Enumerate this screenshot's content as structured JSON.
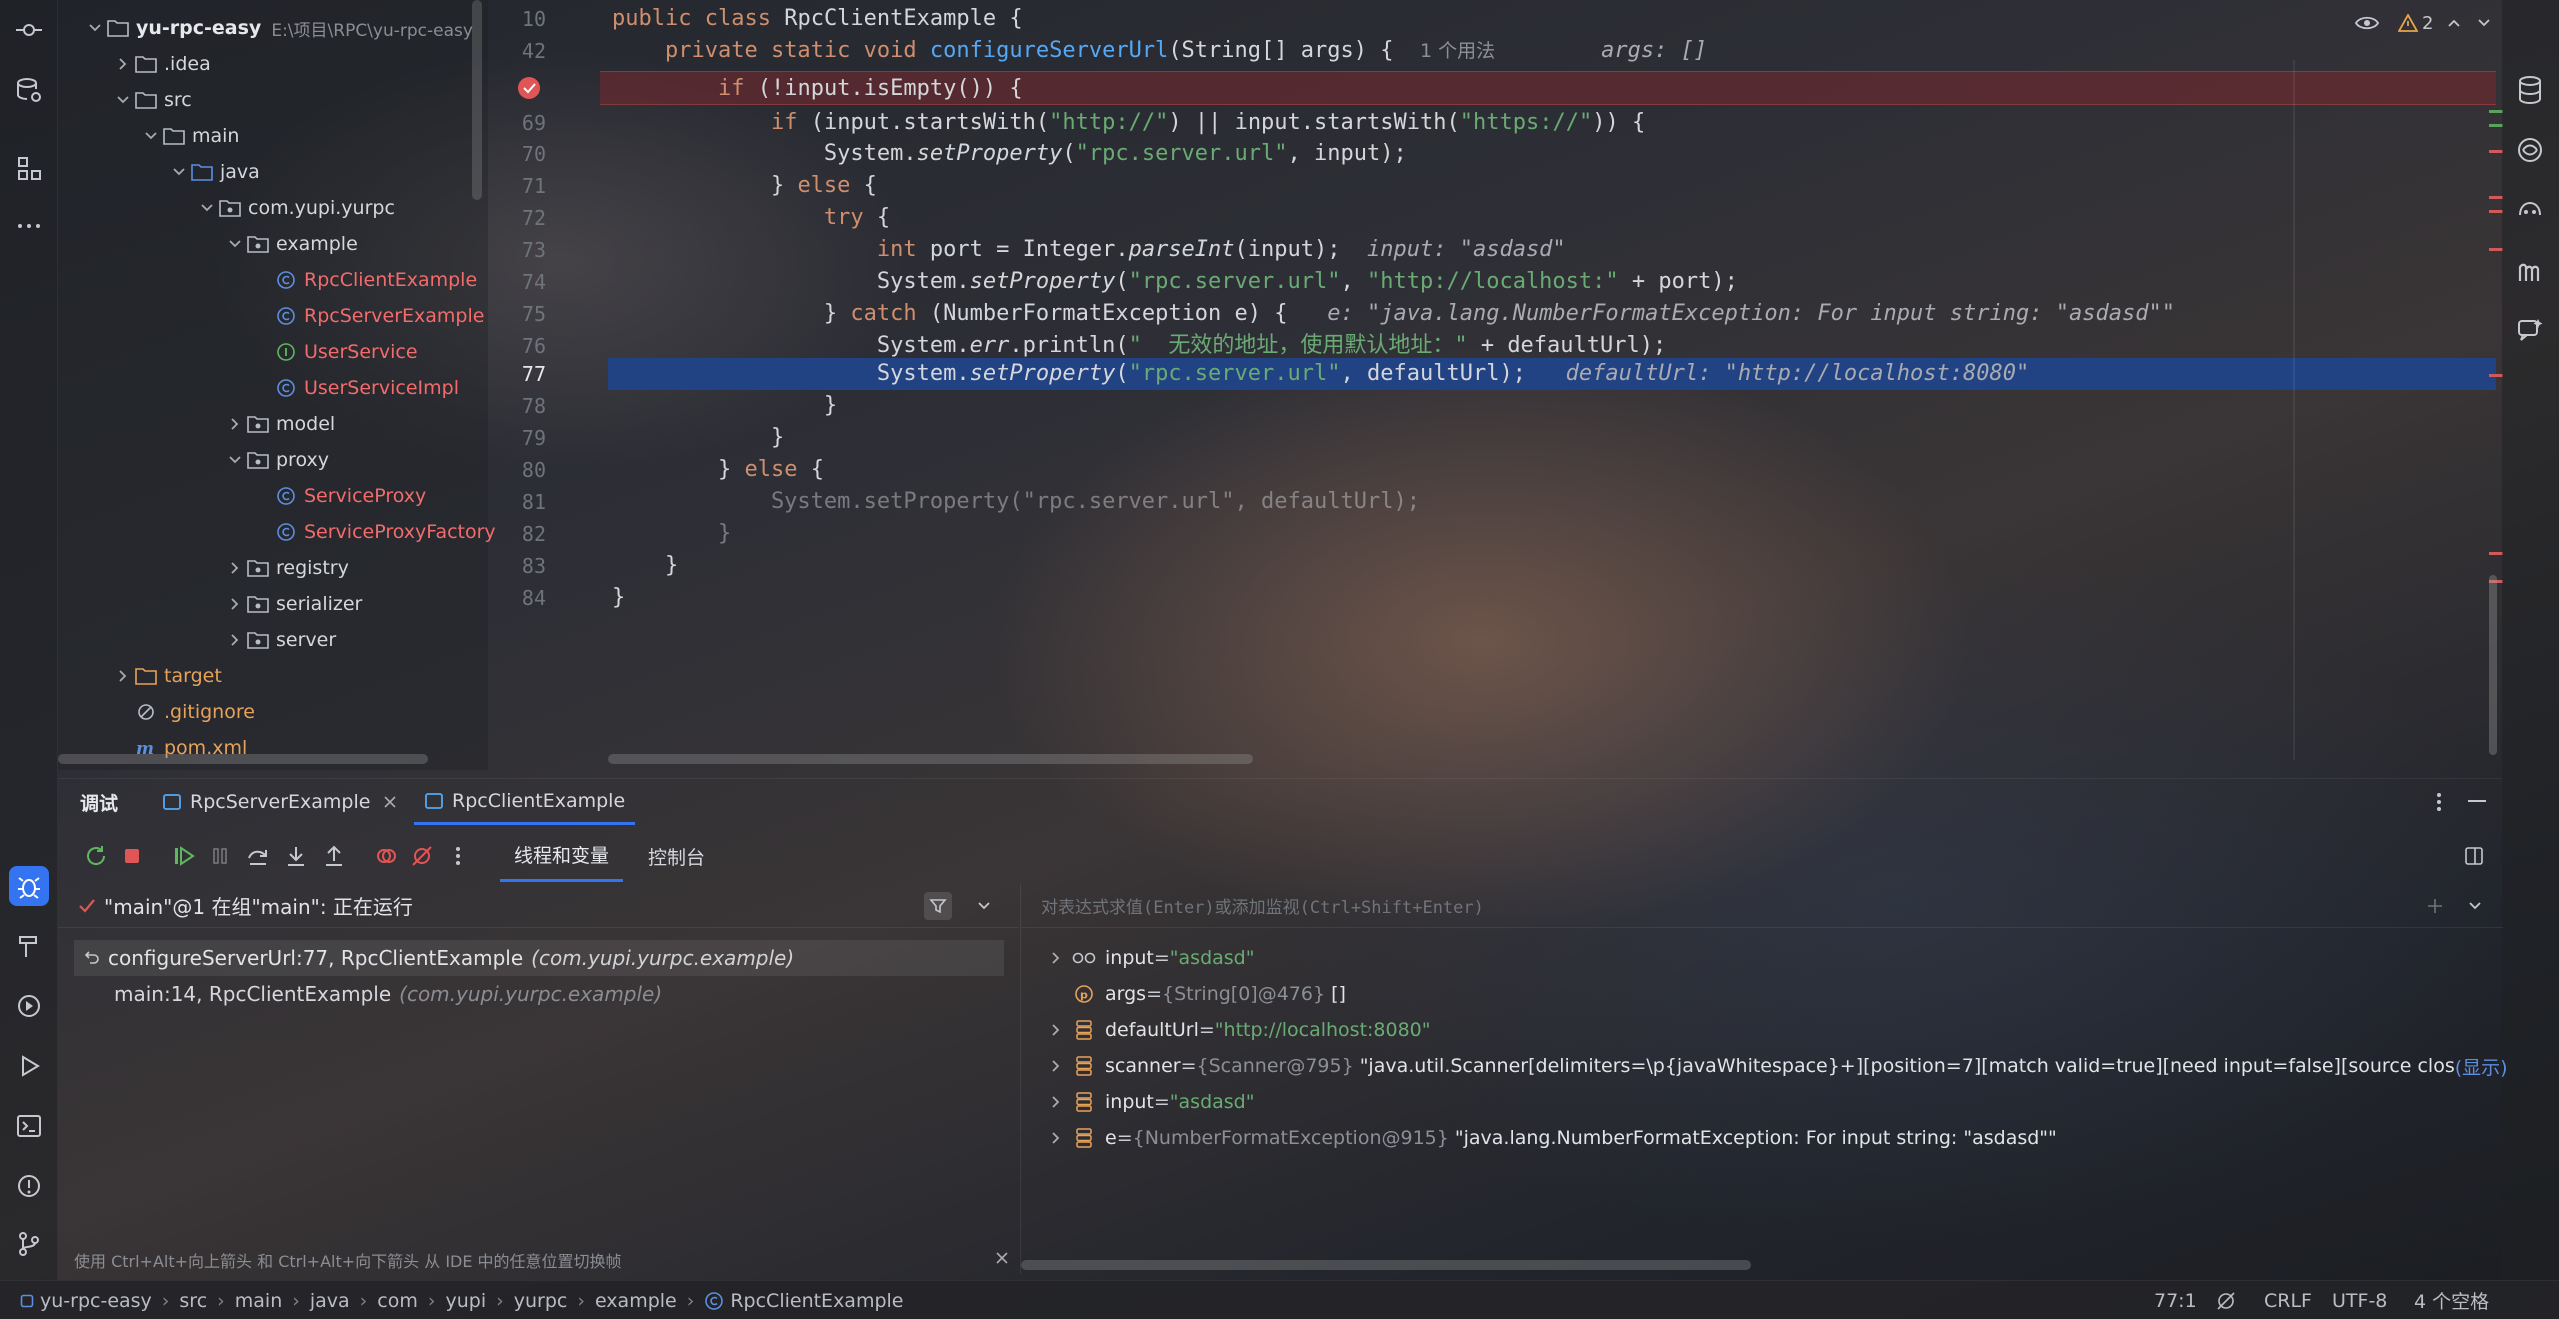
{
  "project": {
    "name": "yu-rpc-easy",
    "path": "E:\\项目\\RPC\\yu-rpc-easy",
    "tree": [
      {
        "label": ".idea",
        "depth": 1,
        "kind": "folder",
        "expanded": false
      },
      {
        "label": "src",
        "depth": 1,
        "kind": "folder",
        "expanded": true
      },
      {
        "label": "main",
        "depth": 2,
        "kind": "folder",
        "expanded": true
      },
      {
        "label": "java",
        "depth": 3,
        "kind": "folder-blue",
        "expanded": true
      },
      {
        "label": "com.yupi.yurpc",
        "depth": 4,
        "kind": "package",
        "expanded": true
      },
      {
        "label": "example",
        "depth": 5,
        "kind": "package",
        "expanded": true
      },
      {
        "label": "RpcClientExample",
        "depth": 6,
        "kind": "class",
        "color": "red"
      },
      {
        "label": "RpcServerExample",
        "depth": 6,
        "kind": "class",
        "color": "red"
      },
      {
        "label": "UserService",
        "depth": 6,
        "kind": "interface",
        "color": "red"
      },
      {
        "label": "UserServiceImpl",
        "depth": 6,
        "kind": "class",
        "color": "red"
      },
      {
        "label": "model",
        "depth": 5,
        "kind": "package",
        "expanded": false
      },
      {
        "label": "proxy",
        "depth": 5,
        "kind": "package",
        "expanded": true
      },
      {
        "label": "ServiceProxy",
        "depth": 6,
        "kind": "class",
        "color": "red"
      },
      {
        "label": "ServiceProxyFactory",
        "depth": 6,
        "kind": "class",
        "color": "red"
      },
      {
        "label": "registry",
        "depth": 5,
        "kind": "package",
        "expanded": false
      },
      {
        "label": "serializer",
        "depth": 5,
        "kind": "package",
        "expanded": false
      },
      {
        "label": "server",
        "depth": 5,
        "kind": "package",
        "expanded": false
      },
      {
        "label": "target",
        "depth": 1,
        "kind": "folder-orange",
        "expanded": false,
        "color": "orange"
      },
      {
        "label": ".gitignore",
        "depth": 1,
        "kind": "ignore",
        "color": "orange"
      },
      {
        "label": "pom.xml",
        "depth": 1,
        "kind": "maven",
        "color": "orange"
      }
    ]
  },
  "editor": {
    "inspection_count": "2",
    "lines": [
      {
        "n": "10",
        "code": [
          [
            "kw",
            "public "
          ],
          [
            "kw",
            "class "
          ],
          [
            "",
            "RpcClientExample {"
          ]
        ]
      },
      {
        "n": "42",
        "code": [
          [
            "",
            "    "
          ],
          [
            "kw",
            "private static void "
          ],
          [
            "fn",
            "configureServerUrl"
          ],
          [
            "",
            "(String[] args) {  "
          ],
          [
            "hint2",
            "1 个用法"
          ],
          [
            "",
            "        "
          ],
          [
            "hint",
            "args: []"
          ]
        ]
      },
      {
        "n": "",
        "code": [
          [
            "",
            "        "
          ],
          [
            "kw",
            "if "
          ],
          [
            "",
            "(!input.isEmpty()) {"
          ]
        ]
      },
      {
        "n": "69",
        "code": [
          [
            "",
            "            "
          ],
          [
            "kw",
            "if "
          ],
          [
            "",
            "(input.startsWith("
          ],
          [
            "str",
            "\"http://\""
          ],
          [
            "",
            ") || input.startsWith("
          ],
          [
            "str",
            "\"https://\""
          ],
          [
            "",
            ")) {"
          ]
        ]
      },
      {
        "n": "70",
        "code": [
          [
            "",
            "                System."
          ],
          [
            "it",
            "setProperty"
          ],
          [
            "",
            "("
          ],
          [
            "str",
            "\"rpc.server.url\""
          ],
          [
            "",
            ", input);"
          ]
        ]
      },
      {
        "n": "71",
        "code": [
          [
            "",
            "            } "
          ],
          [
            "kw",
            "else "
          ],
          [
            "",
            "{"
          ]
        ]
      },
      {
        "n": "72",
        "code": [
          [
            "",
            "                "
          ],
          [
            "kw",
            "try "
          ],
          [
            "",
            "{"
          ]
        ]
      },
      {
        "n": "73",
        "code": [
          [
            "",
            "                    "
          ],
          [
            "kw",
            "int "
          ],
          [
            "",
            "port = Integer."
          ],
          [
            "it",
            "parseInt"
          ],
          [
            "",
            "(input);  "
          ],
          [
            "hint",
            "input: \"asdasd\""
          ]
        ]
      },
      {
        "n": "74",
        "code": [
          [
            "",
            "                    System."
          ],
          [
            "it",
            "setProperty"
          ],
          [
            "",
            "("
          ],
          [
            "str",
            "\"rpc.server.url\""
          ],
          [
            "",
            ", "
          ],
          [
            "str",
            "\"http://localhost:\""
          ],
          [
            "",
            " + port);"
          ]
        ]
      },
      {
        "n": "75",
        "code": [
          [
            "",
            "                } "
          ],
          [
            "kw",
            "catch "
          ],
          [
            "",
            "(NumberFormatException e) {   "
          ],
          [
            "hint",
            "e: \"java.lang.NumberFormatException: For input string: \"asdasd\"\""
          ]
        ]
      },
      {
        "n": "76",
        "code": [
          [
            "",
            "                    System."
          ],
          [
            "it",
            "err"
          ],
          [
            "",
            ".println("
          ],
          [
            "str",
            "\"  无效的地址，使用默认地址：\""
          ],
          [
            "",
            " + defaultUrl);"
          ]
        ]
      },
      {
        "n": "77",
        "code": [
          [
            "",
            "                    System."
          ],
          [
            "it",
            "setProperty"
          ],
          [
            "",
            "("
          ],
          [
            "str",
            "\"rpc.server.url\""
          ],
          [
            "",
            ", defaultUrl);   "
          ],
          [
            "hint",
            "defaultUrl: \"http://localhost:8080\""
          ]
        ]
      },
      {
        "n": "78",
        "code": [
          [
            "",
            "                }"
          ]
        ]
      },
      {
        "n": "79",
        "code": [
          [
            "",
            "            }"
          ]
        ]
      },
      {
        "n": "80",
        "code": [
          [
            "",
            "        } "
          ],
          [
            "kw",
            "else "
          ],
          [
            "",
            "{"
          ]
        ]
      },
      {
        "n": "81",
        "code": [
          [
            "dimcode",
            "            System.setProperty(\"rpc.server.url\", defaultUrl);"
          ]
        ]
      },
      {
        "n": "82",
        "code": [
          [
            "dimcode",
            "        }"
          ]
        ]
      },
      {
        "n": "83",
        "code": [
          [
            "",
            "    }"
          ]
        ]
      },
      {
        "n": "84",
        "code": [
          [
            "",
            "}"
          ]
        ]
      }
    ]
  },
  "debug": {
    "panel_title": "调试",
    "tabs": [
      "RpcServerExample",
      "RpcClientExample"
    ],
    "subtabs": [
      "线程和变量",
      "控制台"
    ],
    "thread_label": "\"main\"@1 在组\"main\": 正在运行",
    "frames": [
      {
        "method": "configureServerUrl:77, RpcClientExample",
        "pkg": "(com.yupi.yurpc.example)"
      },
      {
        "method": "main:14, RpcClientExample",
        "pkg": "(com.yupi.yurpc.example)"
      }
    ],
    "eval_placeholder": "对表达式求值(Enter)或添加监视(Ctrl+Shift+Enter)",
    "variables": [
      {
        "name": "input",
        "type": "",
        "value": "\"asdasd\"",
        "icon": "watch",
        "expandable": true
      },
      {
        "name": "args",
        "type": "{String[0]@476}",
        "value": "[]",
        "icon": "param",
        "expandable": false
      },
      {
        "name": "defaultUrl",
        "type": "",
        "value": "\"http://localhost:8080\"",
        "icon": "field",
        "expandable": true
      },
      {
        "name": "scanner",
        "type": "{Scanner@795}",
        "value": "\"java.util.Scanner[delimiters=\\p{javaWhitespace}+][position=7][match valid=true][need input=false][source closed=false][skippe...",
        "icon": "field",
        "expandable": true,
        "more": "(显示)"
      },
      {
        "name": "input",
        "type": "",
        "value": "\"asdasd\"",
        "icon": "field",
        "expandable": true
      },
      {
        "name": "e",
        "type": "{NumberFormatException@915}",
        "value": "\"java.lang.NumberFormatException: For input string: \"asdasd\"\"",
        "icon": "field",
        "expandable": true
      }
    ],
    "hint_text": "使用 Ctrl+Alt+向上箭头 和 Ctrl+Alt+向下箭头 从 IDE 中的任意位置切换帧"
  },
  "status": {
    "breadcrumbs": [
      "yu-rpc-easy",
      "src",
      "main",
      "java",
      "com",
      "yupi",
      "yurpc",
      "example",
      "RpcClientExample"
    ],
    "position": "77:1",
    "line_sep": "CRLF",
    "encoding": "UTF-8",
    "indent": "4 个空格"
  },
  "colors": {
    "keyword": "#cf8e6d",
    "string": "#6aab73",
    "function": "#56a8f5",
    "breakpoint": "#e05555",
    "exec_line": "#214283",
    "accent": "#3574f0"
  }
}
